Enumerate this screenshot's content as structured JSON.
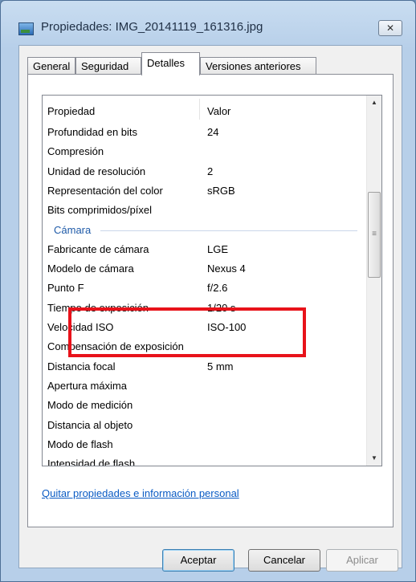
{
  "window": {
    "title": "Propiedades: IMG_20141119_161316.jpg",
    "close_label": "✕"
  },
  "tabs": [
    "General",
    "Seguridad",
    "Detalles",
    "Versiones anteriores"
  ],
  "active_tab": "Detalles",
  "list": {
    "headers": {
      "property": "Propiedad",
      "value": "Valor"
    },
    "rows_before": [
      {
        "name": "Profundidad en bits",
        "value": "24"
      },
      {
        "name": "Compresión",
        "value": ""
      },
      {
        "name": "Unidad de resolución",
        "value": "2"
      },
      {
        "name": "Representación del color",
        "value": "sRGB"
      },
      {
        "name": "Bits comprimidos/píxel",
        "value": ""
      }
    ],
    "group": "Cámara",
    "rows_after": [
      {
        "name": "Fabricante de cámara",
        "value": "LGE"
      },
      {
        "name": "Modelo de cámara",
        "value": "Nexus 4"
      },
      {
        "name": "Punto F",
        "value": "f/2.6"
      },
      {
        "name": "Tiempo de exposición",
        "value": "1/20 s"
      },
      {
        "name": "Velocidad ISO",
        "value": "ISO-100"
      },
      {
        "name": "Compensación de exposición",
        "value": ""
      },
      {
        "name": "Distancia focal",
        "value": "5 mm"
      },
      {
        "name": "Apertura máxima",
        "value": ""
      },
      {
        "name": "Modo de medición",
        "value": ""
      },
      {
        "name": "Distancia al objeto",
        "value": ""
      },
      {
        "name": "Modo de flash",
        "value": ""
      },
      {
        "name": "Intensidad de flash",
        "value": ""
      }
    ]
  },
  "link": "Quitar propiedades e información personal",
  "buttons": {
    "ok": "Aceptar",
    "cancel": "Cancelar",
    "apply": "Aplicar"
  },
  "colors": {
    "highlight": "#e8121a",
    "link": "#0a5bc4",
    "group": "#1e5aa8"
  }
}
